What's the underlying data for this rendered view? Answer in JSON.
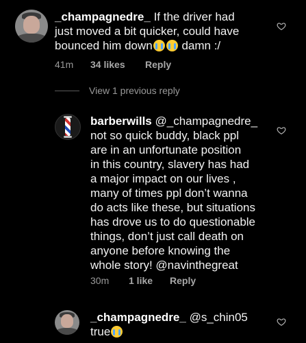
{
  "comments": [
    {
      "username": "_champagnedre_",
      "line1": "If the driver had",
      "line2": "just moved a bit quicker, could have",
      "line3_pre": "bounced him down",
      "line3_post": "damn :/",
      "time": "41m",
      "likes": "34 likes",
      "reply": "Reply"
    },
    {
      "username": "barberwills",
      "mention": "@_champagnedre_",
      "lines": [
        "not so quick buddy, black ppl",
        "are in an unfortunate position",
        "in this country, slavery has had",
        "a major impact on our lives ,",
        "many of times ppl don’t wanna",
        "do acts like these, but situations",
        "has drove us to do questionable",
        "things, don’t just call death on",
        "anyone before knowing the"
      ],
      "last_line": "whole story! @navinthegreat",
      "time": "30m",
      "likes": "1 like",
      "reply": "Reply"
    },
    {
      "username": "_champagnedre_",
      "mention": "@s_chin05",
      "text": "true"
    }
  ],
  "view_previous": "View 1 previous reply",
  "icons": {
    "like": "heart-outline-icon",
    "emoji": "loudly-crying-face-emoji"
  }
}
